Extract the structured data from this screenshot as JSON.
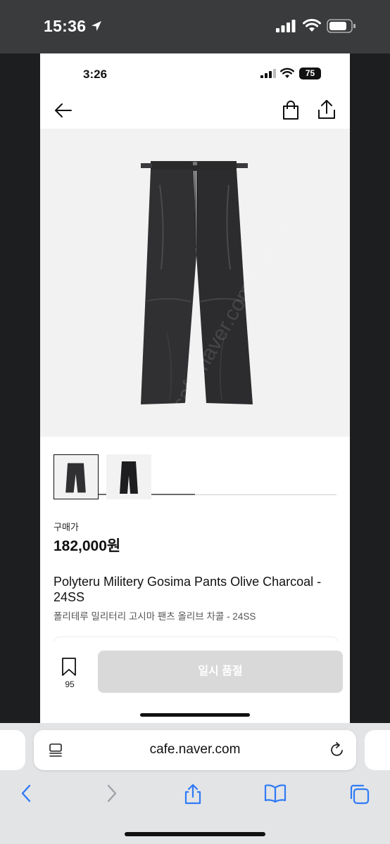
{
  "outer_status": {
    "time": "15:36"
  },
  "inner_status": {
    "time": "3:26",
    "battery": "75"
  },
  "product": {
    "price_label": "구매가",
    "price": "182,000원",
    "title": "Polyteru Militery Gosima Pants Olive Charcoal - 24SS",
    "title_korean": "폴리테루 밀리터리 고시마 팬츠 올리브 차콜 - 24SS",
    "watermark": "cafe.naver.com/fruitsfa",
    "image_progress": 0.5
  },
  "bottom": {
    "bookmark_count": "95",
    "soldout_label": "일시 품절"
  },
  "browser": {
    "url": "cafe.naver.com"
  },
  "icons": {
    "back": "arrow-left-icon",
    "bag": "shopping-bag-icon",
    "share": "share-icon",
    "bookmark": "bookmark-icon",
    "reader": "reader-mode-icon",
    "reload": "reload-icon",
    "nav_back": "chevron-left-icon",
    "nav_forward": "chevron-right-icon",
    "safari_share": "share-icon",
    "bookmarks": "book-icon",
    "tabs": "tabs-icon"
  },
  "colors": {
    "soldout_bg": "#d9d9d9",
    "safari_blue": "#2f7bf6",
    "product_bg": "#f2f2f2"
  }
}
